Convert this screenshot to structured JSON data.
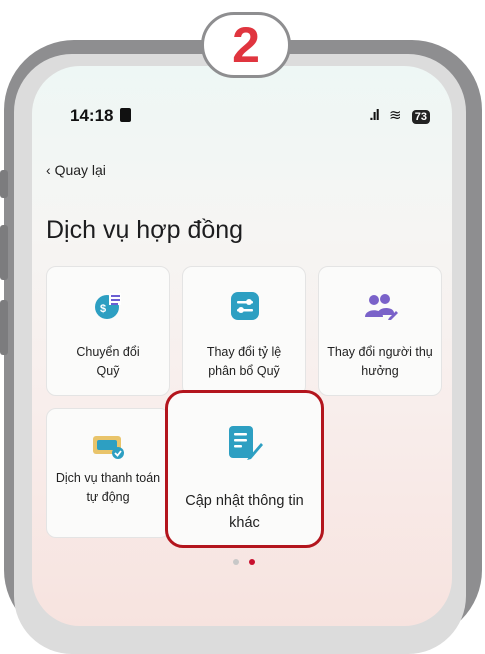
{
  "step_badge": "2",
  "status": {
    "time": "14:18",
    "battery": "73"
  },
  "nav": {
    "back_label": "Quay lại"
  },
  "page": {
    "title": "Dịch vụ hợp đồng"
  },
  "services": [
    {
      "line1": "Chuyển đổi",
      "line2": "Quỹ",
      "icon": "fund-switch-icon"
    },
    {
      "line1": "Thay đổi tỷ lệ",
      "line2": "phân bổ Quỹ",
      "icon": "allocation-sliders-icon"
    },
    {
      "line1": "Thay đổi người thụ",
      "line2": "hưởng",
      "icon": "beneficiary-users-icon"
    },
    {
      "line1": "Dịch vụ thanh toán",
      "line2": "tự động",
      "icon": "auto-payment-card-icon"
    },
    {
      "line1": "Cập nhật thông tin",
      "line2": "khác",
      "icon": "edit-document-icon"
    }
  ],
  "colors": {
    "accent": "#2d9fc2",
    "highlight": "#b3151d",
    "badge": "#e0353f"
  }
}
